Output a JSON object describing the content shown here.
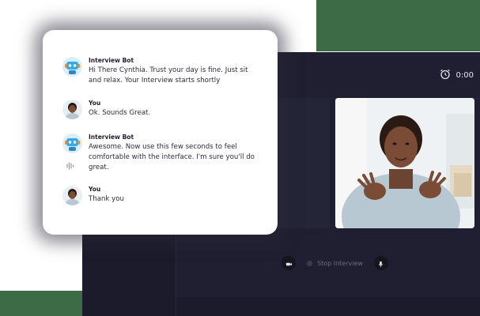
{
  "timer": {
    "value": "0:00",
    "icon": "alarm-clock-icon"
  },
  "controls": {
    "camera_icon": "video-camera-icon",
    "stop_label": "Stop Interview",
    "mic_icon": "microphone-icon"
  },
  "chat": {
    "messages": [
      {
        "sender": "Interview Bot",
        "text": "Hi There Cynthia. Trust your day is fine. Just sit and relax. Your Interview starts shortly",
        "avatar": "robot-avatar"
      },
      {
        "sender": "You",
        "text": "Ok. Sounds Great.",
        "avatar": "user-avatar"
      },
      {
        "sender": "Interview Bot",
        "text": "Awesome. Now use this few seconds to feel comfortable with the interface. I'm sure you'll do great.",
        "avatar": "robot-avatar",
        "audio_icon": "sound-wave-icon"
      },
      {
        "sender": "You",
        "text": "Thank you",
        "avatar": "user-avatar"
      }
    ]
  },
  "colors": {
    "background_dark": "#1f1f31",
    "accent_green": "#3d6b45",
    "bot_blue": "#3ba7e0",
    "bot_orange": "#f28c2f"
  }
}
